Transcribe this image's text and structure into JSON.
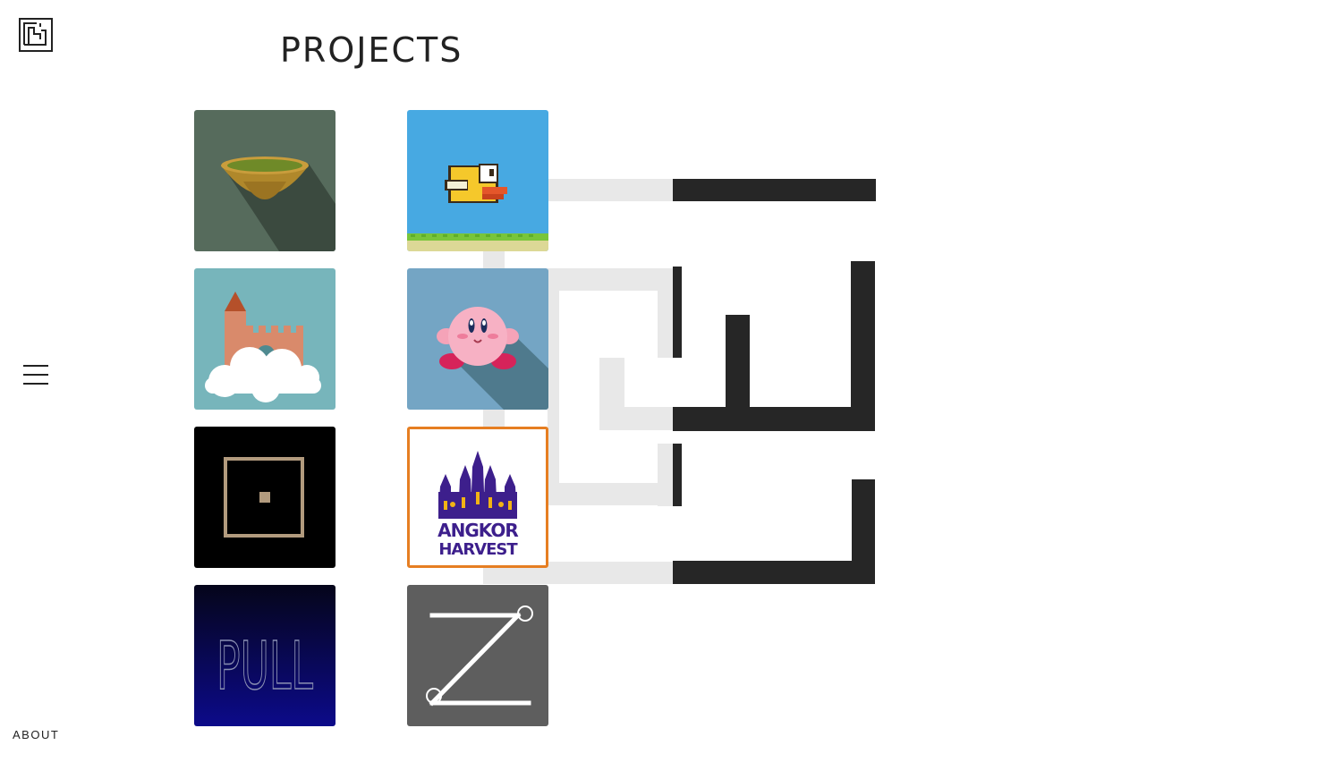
{
  "header": {
    "title": "PROJECTS"
  },
  "nav": {
    "about_label": "ABOUT"
  },
  "colors": {
    "selected_border": "#e67e22",
    "maze_dark": "#262626",
    "maze_light": "#e8e8e8"
  },
  "projects": [
    {
      "icon": "matcha-bowl-icon"
    },
    {
      "icon": "flappy-bird-icon"
    },
    {
      "icon": "castle-icon"
    },
    {
      "icon": "kirby-icon"
    },
    {
      "icon": "square-frame-icon"
    },
    {
      "icon": "angkor-harvest-logo",
      "logo_line1": "ANGKOR",
      "logo_line2": "HARVEST",
      "selected": true
    },
    {
      "icon": "pull-icon",
      "label": "PULL"
    },
    {
      "icon": "z-letter-icon"
    }
  ]
}
